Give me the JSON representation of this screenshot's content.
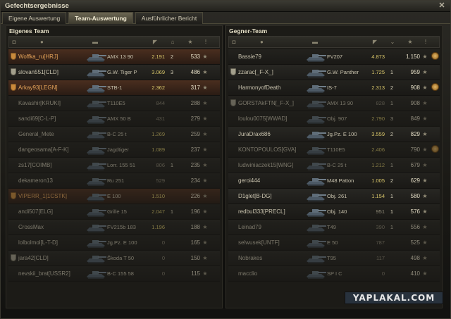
{
  "window": {
    "title": "Gefechtsergebnisse",
    "close_glyph": "✕"
  },
  "tabs": [
    {
      "label": "Eigene Auswertung",
      "active": false
    },
    {
      "label": "Team-Auswertung",
      "active": true
    },
    {
      "label": "Ausführlicher Bericht",
      "active": false
    }
  ],
  "left": {
    "title": "Eigenes Team",
    "rows": [
      {
        "player": "Woffka_ru[HRJ]",
        "tank": "AMX 13 90",
        "damage": "2.191",
        "kills": "2",
        "xp": "533",
        "platoon": "orange",
        "self": true
      },
      {
        "player": "slovan551[CLD]",
        "tank": "G.W. Tiger P",
        "damage": "3.069",
        "kills": "3",
        "xp": "486",
        "platoon": "grey"
      },
      {
        "player": "Arkay93[LEGN]",
        "tank": "STB-1",
        "damage": "2.362",
        "kills": "",
        "xp": "317",
        "platoon": "orange",
        "self": true
      },
      {
        "player": "Kavashir[KRUKI]",
        "tank": "T110E5",
        "damage": "844",
        "kills": "",
        "xp": "288",
        "dead": true
      },
      {
        "player": "sandi69[C-L-P]",
        "tank": "AMX 50 B",
        "damage": "431",
        "kills": "",
        "xp": "279",
        "dead": true
      },
      {
        "player": "General_Mete",
        "tank": "B-C 25 t",
        "damage": "1.269",
        "kills": "",
        "xp": "259",
        "dead": true
      },
      {
        "player": "dangeosama[A-F-K]",
        "tank": "Jagdtiger",
        "damage": "1.089",
        "kills": "",
        "xp": "237",
        "dead": true
      },
      {
        "player": "zs17[COIMB]",
        "tank": "Lorr. 155 51",
        "damage": "806",
        "kills": "1",
        "xp": "235",
        "dead": true
      },
      {
        "player": "dekameron13",
        "tank": "Ru 251",
        "damage": "529",
        "kills": "",
        "xp": "234",
        "dead": true
      },
      {
        "player": "VIPERR_1[1CSTK]",
        "tank": "E 100",
        "damage": "1.510",
        "kills": "",
        "xp": "226",
        "platoon": "orange",
        "self": true,
        "dead": true
      },
      {
        "player": "andi507[ELG]",
        "tank": "Grille 15",
        "damage": "2.047",
        "kills": "1",
        "xp": "196",
        "dead": true
      },
      {
        "player": "CrossMax",
        "tank": "FV215b 183",
        "damage": "1.196",
        "kills": "",
        "xp": "188",
        "dead": true
      },
      {
        "player": "lolbolmol[L-T-D]",
        "tank": "Jg.Pz. E 100",
        "damage": "0",
        "kills": "",
        "xp": "165",
        "dead": true
      },
      {
        "player": "jara42[CLD]",
        "tank": "Škoda T 50",
        "damage": "0",
        "kills": "",
        "xp": "150",
        "platoon": "grey",
        "dead": true
      },
      {
        "player": "nevskii_brat[USSR2]",
        "tank": "B-C 155 58",
        "damage": "0",
        "kills": "",
        "xp": "115",
        "dead": true
      }
    ]
  },
  "right": {
    "title": "Gegner-Team",
    "rows": [
      {
        "player": "Bassie79",
        "tank": "FV207",
        "damage": "4.873",
        "kills": "",
        "xp": "1.150",
        "medal": true
      },
      {
        "player": "zzarac[_F-X_]",
        "tank": "G.W. Panther",
        "damage": "1.725",
        "kills": "1",
        "xp": "959",
        "platoon": "grey"
      },
      {
        "player": "HarmonyofDeath",
        "tank": "IS-7",
        "damage": "2.313",
        "kills": "2",
        "xp": "908",
        "medal": true
      },
      {
        "player": "GORSTAkFTN[_F-X_]",
        "tank": "AMX 13 90",
        "damage": "828",
        "kills": "1",
        "xp": "908",
        "platoon": "grey",
        "dead": true
      },
      {
        "player": "loulou0075[WWAD]",
        "tank": "Obj. 907",
        "damage": "2.790",
        "kills": "3",
        "xp": "849",
        "dead": true
      },
      {
        "player": "JuraDrax686",
        "tank": "Jg.Pz. E 100",
        "damage": "3.559",
        "kills": "2",
        "xp": "829"
      },
      {
        "player": "KONTOPOULOS[GVA]",
        "tank": "T110E5",
        "damage": "2.406",
        "kills": "",
        "xp": "790",
        "medal": true,
        "dead": true
      },
      {
        "player": "ludwiniaczek15[WNG]",
        "tank": "B-C 25 t",
        "damage": "1.212",
        "kills": "1",
        "xp": "679",
        "dead": true
      },
      {
        "player": "geroi444",
        "tank": "M48 Patton",
        "damage": "1.005",
        "kills": "2",
        "xp": "629"
      },
      {
        "player": "D1glet[B-DG]",
        "tank": "Obj. 261",
        "damage": "1.154",
        "kills": "1",
        "xp": "580"
      },
      {
        "player": "redbul333[PRECL]",
        "tank": "Obj. 140",
        "damage": "951",
        "kills": "1",
        "xp": "576"
      },
      {
        "player": "Leinad79",
        "tank": "T49",
        "damage": "390",
        "kills": "1",
        "xp": "556",
        "dead": true
      },
      {
        "player": "selwusek[UNTF]",
        "tank": "E 50",
        "damage": "787",
        "kills": "",
        "xp": "525",
        "dead": true
      },
      {
        "player": "Nobrakes",
        "tank": "T95",
        "damage": "117",
        "kills": "",
        "xp": "498",
        "dead": true
      },
      {
        "player": "macclio",
        "tank": "SP I C",
        "damage": "0",
        "kills": "",
        "xp": "410",
        "dead": true
      }
    ]
  },
  "star_glyph": "★",
  "watermark": "YAPLAKAL.COM"
}
